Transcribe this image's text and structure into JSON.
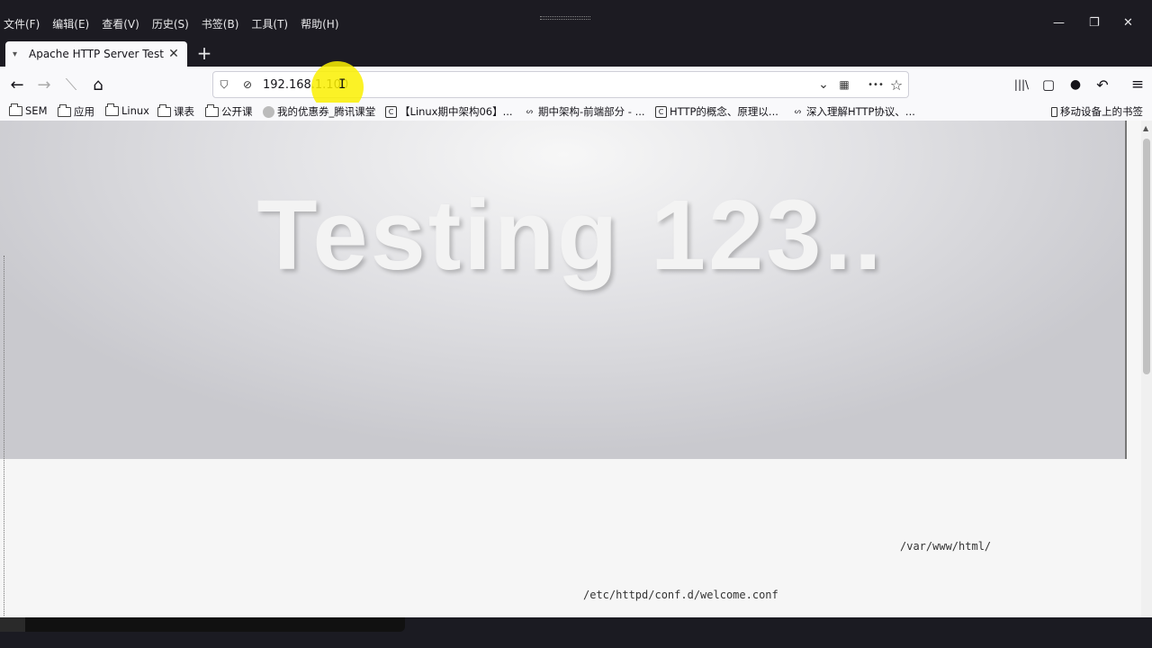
{
  "menubar": {
    "items": [
      "文件(F)",
      "编辑(E)",
      "查看(V)",
      "历史(S)",
      "书签(B)",
      "工具(T)",
      "帮助(H)"
    ]
  },
  "window_controls": {
    "minimize": "—",
    "restore": "❐",
    "close": "✕"
  },
  "tab": {
    "title": "Apache HTTP Server Test Pa",
    "close": "✕",
    "new_tab": "+"
  },
  "nav": {
    "back": "←",
    "forward": "→",
    "reload": "⟍",
    "home": "⌂",
    "url": "192.168.1.100",
    "actions": {
      "dropdown": "⌄",
      "more": "•••",
      "bookmark_star": "☆",
      "library": "|||\\",
      "sidebar": "▢",
      "account": "●",
      "undo": "↶",
      "menu": "≡"
    }
  },
  "bookmarks": {
    "items": [
      {
        "label": "SEM",
        "icon": "folder-icon"
      },
      {
        "label": "应用",
        "icon": "folder-icon"
      },
      {
        "label": "Linux",
        "icon": "folder-icon"
      },
      {
        "label": "课表",
        "icon": "folder-icon"
      },
      {
        "label": "公开课",
        "icon": "folder-icon"
      },
      {
        "label": "我的优惠券_腾讯课堂",
        "icon": "globe-icon"
      },
      {
        "label": "【Linux期中架构06】...",
        "icon": "site-icon"
      },
      {
        "label": "期中架构-前端部分 - ...",
        "icon": "site-icon"
      },
      {
        "label": "HTTP的概念、原理以...",
        "icon": "site-icon"
      },
      {
        "label": "深入理解HTTP协议、...",
        "icon": "site-icon"
      }
    ],
    "mobile": "移动设备上的书签"
  },
  "page": {
    "title": "Testing 123..",
    "path1": "/var/www/html/",
    "path2": "/etc/httpd/conf.d/welcome.conf"
  }
}
